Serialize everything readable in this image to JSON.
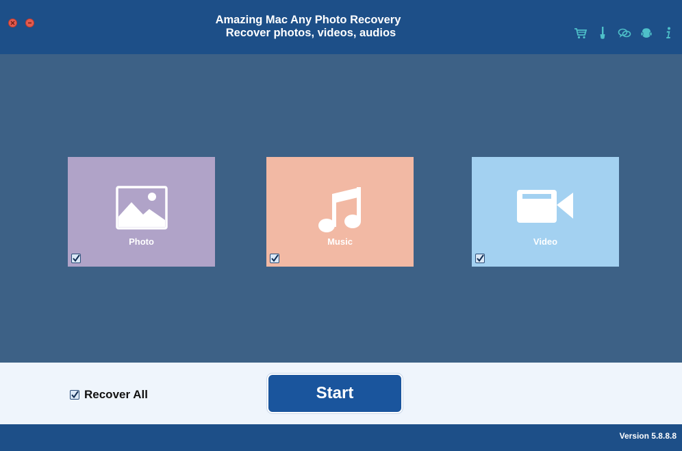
{
  "window": {
    "title_line1": "Amazing Mac Any Photo Recovery",
    "title_line2": "Recover photos, videos, audios",
    "close_color": "#e25b4f",
    "minimize_color": "#e25b4f"
  },
  "toolbar": {
    "icons": [
      "cart-icon",
      "brush-icon",
      "chat-icon",
      "support-icon",
      "info-icon"
    ],
    "icon_color": "#4ec0c9"
  },
  "categories": [
    {
      "label": "Photo",
      "checked": true,
      "color": "#b0a3c8",
      "icon": "image-icon"
    },
    {
      "label": "Music",
      "checked": true,
      "color": "#f2b9a4",
      "icon": "music-note-icon"
    },
    {
      "label": "Video",
      "checked": true,
      "color": "#a3d1f1",
      "icon": "video-camera-icon"
    }
  ],
  "bottom": {
    "recover_all_label": "Recover All",
    "recover_all_checked": true,
    "start_label": "Start"
  },
  "status": {
    "version": "Version 5.8.8.8"
  },
  "colors": {
    "header": "#1d4f88",
    "main_bg": "#3d6186",
    "bottom_bg": "#eff5fc",
    "start_button": "#1a559d"
  }
}
